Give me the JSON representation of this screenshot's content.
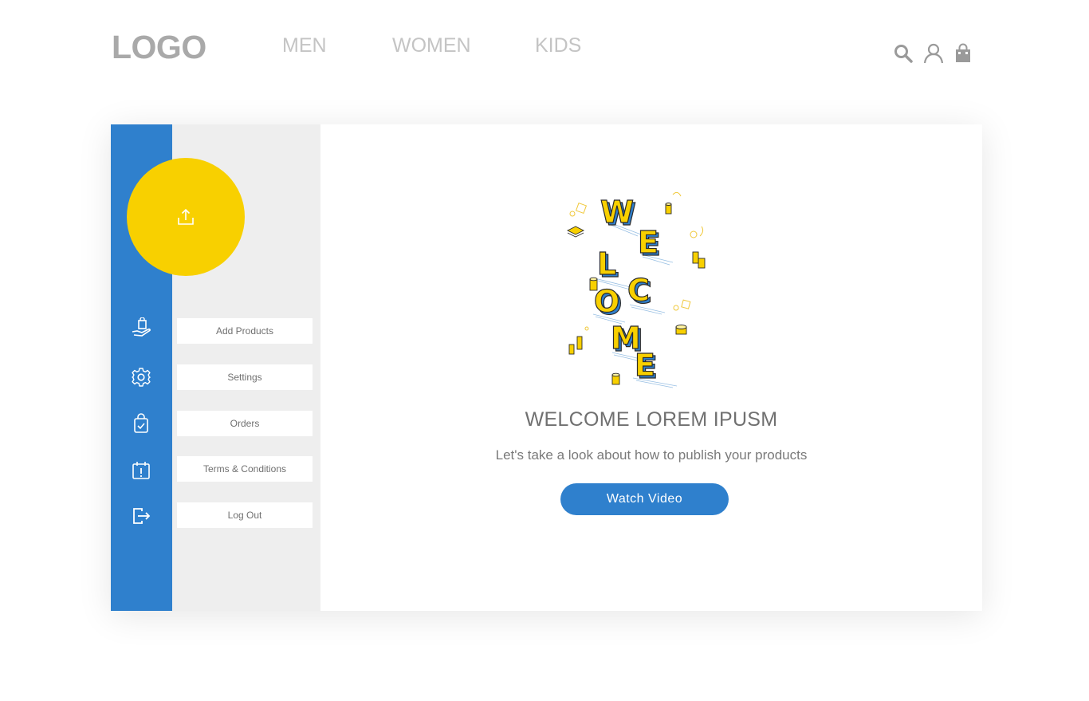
{
  "header": {
    "logo": "LOGO",
    "nav": [
      "MEN",
      "WOMEN",
      "KIDS"
    ],
    "icons": [
      "search-icon",
      "user-icon",
      "shopping-bag-icon"
    ]
  },
  "sidebar": {
    "avatar_icon": "upload-icon",
    "items": [
      {
        "label": "Add Products",
        "icon": "hand-bag-icon"
      },
      {
        "label": "Settings",
        "icon": "gear-icon"
      },
      {
        "label": "Orders",
        "icon": "bag-check-icon"
      },
      {
        "label": "Terms & Conditions",
        "icon": "calendar-alert-icon"
      },
      {
        "label": "Log Out",
        "icon": "logout-icon"
      }
    ]
  },
  "main": {
    "illustration_letters": [
      "W",
      "E",
      "L",
      "C",
      "O",
      "M",
      "E"
    ],
    "title": "WELCOME LOREM IPUSM",
    "subtitle": "Let's take a look about how to publish your products",
    "cta": "Watch Video"
  },
  "colors": {
    "primary": "#2f80cd",
    "accent": "#f8d000",
    "panel": "#eeeeee",
    "muted_text": "#a9a9a9"
  }
}
